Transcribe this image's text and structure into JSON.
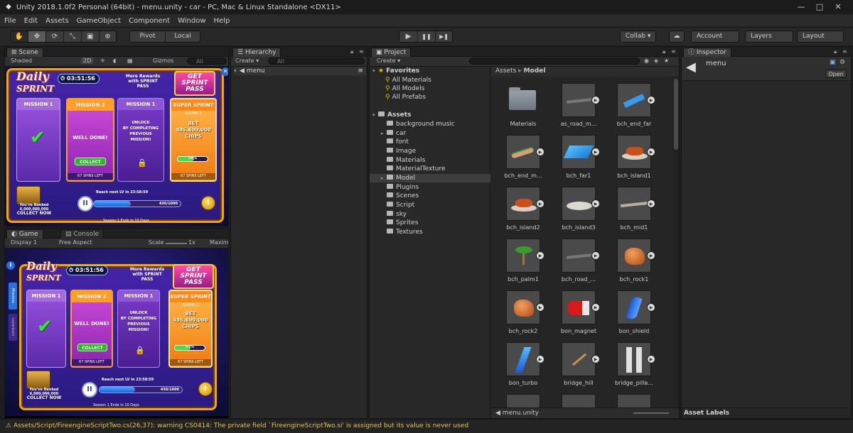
{
  "window": {
    "title": "Unity 2018.1.0f2 Personal (64bit) - menu.unity - car - PC, Mac & Linux Standalone <DX11>",
    "minimize": "—",
    "maximize": "□",
    "close": "✕"
  },
  "menu": [
    "File",
    "Edit",
    "Assets",
    "GameObject",
    "Component",
    "Window",
    "Help"
  ],
  "toolbar": {
    "transform_tools": [
      "✋",
      "✥",
      "⟳",
      "⤡",
      "▣",
      "⊕"
    ],
    "pivot": "Pivot",
    "local": "Local",
    "play": "▶",
    "pause": "❚❚",
    "step": "▶❚",
    "collab": "Collab ▾",
    "cloud": "☁",
    "account": "Account",
    "layers": "Layers",
    "layout": "Layout"
  },
  "scene": {
    "tab": "Scene",
    "shading": "Shaded",
    "mode_2d": "2D",
    "gizmos": "Gizmos",
    "search": "All"
  },
  "game": {
    "tab": "Game",
    "console_tab": "Console",
    "display": "Display 1",
    "aspect": "Free Aspect",
    "scale_label": "Scale",
    "scale_value": "1x",
    "maximize": "Maximi"
  },
  "art": {
    "logo_line1": "Daily",
    "logo_line2": "SPRINT",
    "timer": "03:51:56",
    "rewards_line1": "More Rewards",
    "rewards_line2": "with SPRINT PASS",
    "getpass_line1": "GET SPRINT",
    "getpass_line2": "PASS",
    "mission1": "MISSION 1",
    "mission2": "MISSION 2",
    "mission3": "MISSION 1",
    "super": "SUPER SPRINT",
    "round": "ROUND 1",
    "well_done": "WELL DONE!",
    "collect": "COLLECT",
    "spins_left": "67 SPINS LEFT",
    "unlock": [
      "UNLOCK",
      "BY COMPLETING",
      "PREVIOUS",
      "MISSION!"
    ],
    "bet": [
      "BET",
      "435,600,000",
      "CHIPS"
    ],
    "bet_progress": "54%",
    "bet_progress_fraction": 0.54,
    "bet_progress_bottom": "53%",
    "bet_progress_bottom_fraction": 0.53,
    "banked_line1": "You've Banked",
    "banked_value": "6,000,000,000",
    "collect_now": "COLLECT NOW",
    "reach_lv": "Reach next LV in 23:58:59",
    "lv_progress": "430/1000",
    "lv_fraction": 0.43,
    "season": "Season 1 Ends in 10 Days",
    "side_tab_missions": "Missions",
    "side_tab_leader": "Leaderboard",
    "close": "✕",
    "info": "i"
  },
  "hierarchy": {
    "tab": "Hierarchy",
    "create": "Create ▾",
    "search": "All",
    "scene_root": "menu"
  },
  "project": {
    "tab": "Project",
    "create": "Create ▾",
    "favorites": "Favorites",
    "fav_items": [
      "All Materials",
      "All Models",
      "All Prefabs"
    ],
    "assets": "Assets",
    "folders": [
      "background music",
      "car",
      "font",
      "Image",
      "Materials",
      "MaterialTexture",
      "Model",
      "Plugins",
      "Scenes",
      "Script",
      "sky",
      "Sprites",
      "Textures"
    ],
    "breadcrumb_root": "Assets",
    "breadcrumb_current": "Model",
    "selected_file": "menu.unity",
    "grid": [
      {
        "name": "Materials",
        "kind": "folder"
      },
      {
        "name": "as_road_m...",
        "kind": "road"
      },
      {
        "name": "bch_end_far",
        "kind": "blue-flat"
      },
      {
        "name": "bch_end_m...",
        "kind": "fish"
      },
      {
        "name": "bch_far1",
        "kind": "blue-plane"
      },
      {
        "name": "bch_island1",
        "kind": "island"
      },
      {
        "name": "bch_island2",
        "kind": "island"
      },
      {
        "name": "bch_island3",
        "kind": "disc"
      },
      {
        "name": "bch_mid1",
        "kind": "sand"
      },
      {
        "name": "bch_palm1",
        "kind": "palm"
      },
      {
        "name": "bch_road_...",
        "kind": "road"
      },
      {
        "name": "bch_rock1",
        "kind": "rock"
      },
      {
        "name": "bch_rock2",
        "kind": "rock"
      },
      {
        "name": "bon_magnet",
        "kind": "magnet"
      },
      {
        "name": "bon_shield",
        "kind": "shield"
      },
      {
        "name": "bon_turbo",
        "kind": "turbo"
      },
      {
        "name": "bridge_hill",
        "kind": "stick"
      },
      {
        "name": "bridge_pilla...",
        "kind": "pillar"
      }
    ]
  },
  "inspector": {
    "tab": "Inspector",
    "object": "menu",
    "open": "Open",
    "asset_labels": "Asset Labels"
  },
  "console_message": "Assets/Script/FireengineScriptTwo.cs(26,37): warning CS0414: The private field `FireengineScriptTwo.si' is assigned but its value is never used",
  "colors": {
    "editor_bg": "#282828",
    "warning": "#e0c450",
    "selection": "#3d3d3d"
  }
}
